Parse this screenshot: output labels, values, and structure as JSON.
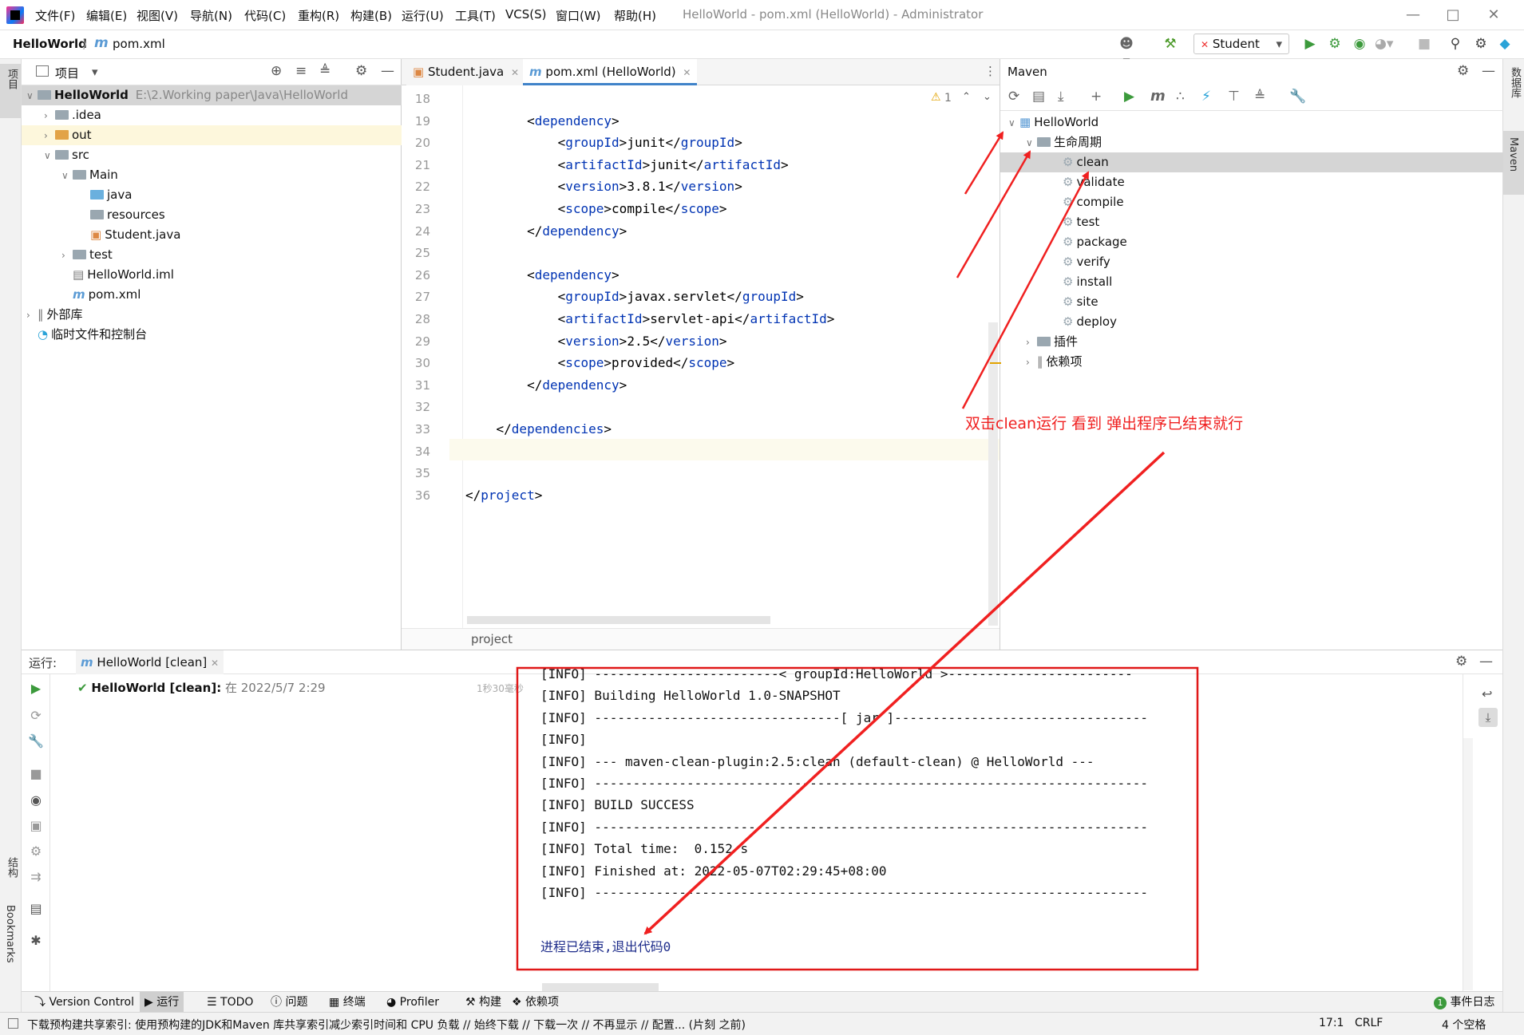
{
  "menu": [
    "文件(F)",
    "编辑(E)",
    "视图(V)",
    "导航(N)",
    "代码(C)",
    "重构(R)",
    "构建(B)",
    "运行(U)",
    "工具(T)",
    "VCS(S)",
    "窗口(W)",
    "帮助(H)"
  ],
  "window_title": "HelloWorld - pom.xml (HelloWorld) - Administrator",
  "nav": {
    "project": "HelloWorld",
    "file": "pom.xml",
    "file_icon": "m"
  },
  "run_config": "Student",
  "left_stripe": {
    "project": "项目",
    "structure": "结构",
    "bookmarks": "Bookmarks"
  },
  "right_stripe": {
    "database": "数据库",
    "maven": "Maven"
  },
  "project_panel": {
    "title": "项目",
    "root": {
      "name": "HelloWorld",
      "path": "E:\\2.Working paper\\Java\\HelloWorld"
    },
    "items": [
      ".idea",
      "out",
      "src",
      "Main",
      "java",
      "resources",
      "Student.java",
      "test",
      "HelloWorld.iml",
      "pom.xml",
      "外部库",
      "临时文件和控制台"
    ]
  },
  "editor": {
    "tabs": [
      "Student.java",
      "pom.xml (HelloWorld)"
    ],
    "warnings": "1",
    "breadcrumb": "project",
    "lines": [
      {
        "n": "18",
        "t": ""
      },
      {
        "n": "19",
        "t": "        <dependency>"
      },
      {
        "n": "20",
        "t": "            <groupId>junit</groupId>"
      },
      {
        "n": "21",
        "t": "            <artifactId>junit</artifactId>"
      },
      {
        "n": "22",
        "t": "            <version>3.8.1</version>"
      },
      {
        "n": "23",
        "t": "            <scope>compile</scope>"
      },
      {
        "n": "24",
        "t": "        </dependency>"
      },
      {
        "n": "25",
        "t": ""
      },
      {
        "n": "26",
        "t": "        <dependency>"
      },
      {
        "n": "27",
        "t": "            <groupId>javax.servlet</groupId>"
      },
      {
        "n": "28",
        "t": "            <artifactId>servlet-api</artifactId>"
      },
      {
        "n": "29",
        "t": "            <version>2.5</version>"
      },
      {
        "n": "30",
        "t": "            <scope>provided</scope>"
      },
      {
        "n": "31",
        "t": "        </dependency>"
      },
      {
        "n": "32",
        "t": ""
      },
      {
        "n": "33",
        "t": "    </dependencies>"
      },
      {
        "n": "34",
        "t": ""
      },
      {
        "n": "35",
        "t": ""
      },
      {
        "n": "36",
        "t": "</project>"
      }
    ]
  },
  "maven": {
    "title": "Maven",
    "root": "HelloWorld",
    "lifecycle": "生命周期",
    "phases": [
      "clean",
      "validate",
      "compile",
      "test",
      "package",
      "verify",
      "install",
      "site",
      "deploy"
    ],
    "plugins": "插件",
    "dependencies": "依赖项"
  },
  "annotation": "双击clean运行 看到 弹出程序已结束就行",
  "run": {
    "label": "运行:",
    "tab": "HelloWorld [clean]",
    "entry_name": "HelloWorld [clean]:",
    "entry_time": "在 2022/5/7 2:29",
    "duration": "1秒30毫秒",
    "console": [
      "[INFO] ------------------------< groupId:HelloWorld >------------------------",
      "[INFO] Building HelloWorld 1.0-SNAPSHOT",
      "[INFO] --------------------------------[ jar ]---------------------------------",
      "[INFO]",
      "[INFO] --- maven-clean-plugin:2.5:clean (default-clean) @ HelloWorld ---",
      "[INFO] ------------------------------------------------------------------------",
      "[INFO] BUILD SUCCESS",
      "[INFO] ------------------------------------------------------------------------",
      "[INFO] Total time:  0.152 s",
      "[INFO] Finished at: 2022-05-07T02:29:45+08:00",
      "[INFO] ------------------------------------------------------------------------"
    ],
    "exit": "进程已结束,退出代码0"
  },
  "bottom_tabs": [
    "Version Control",
    "运行",
    "TODO",
    "问题",
    "终端",
    "Profiler",
    "构建",
    "依赖项"
  ],
  "event_log": "事件日志",
  "event_count": "1",
  "status": {
    "message": "下载预构建共享索引: 使用预构建的JDK和Maven 库共享索引减少索引时间和 CPU 负载 // 始终下载 // 下载一次 // 不再显示 // 配置... (片刻 之前)",
    "position": "17:1",
    "line_sep": "CRLF",
    "indent": "4 个空格"
  }
}
